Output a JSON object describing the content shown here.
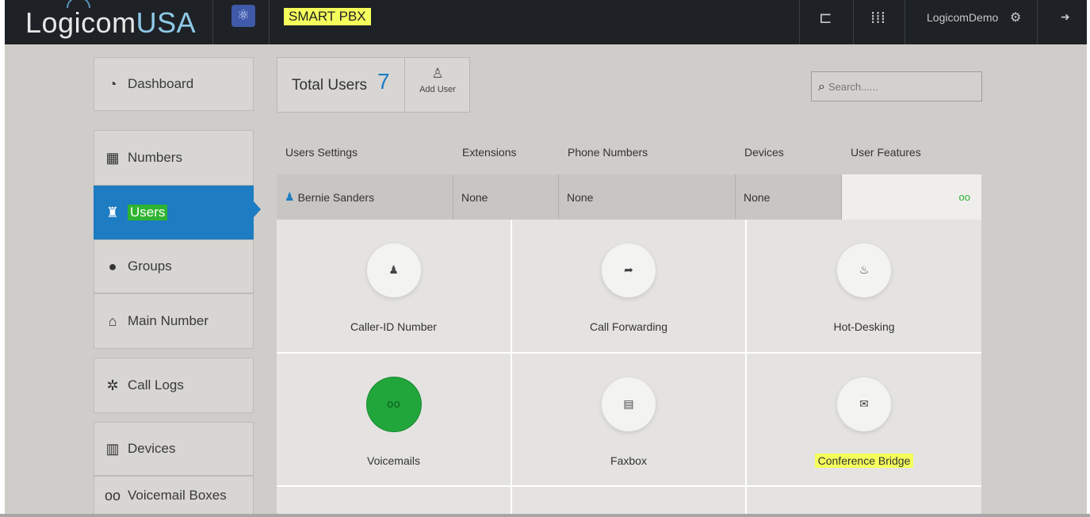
{
  "header": {
    "logo_main": "Logicom",
    "logo_accent": "USA",
    "app_title": "SMART PBX",
    "username": "LogicomDemo",
    "icons": [
      "sitemap-icon",
      "apps-grid-icon",
      "gears-icon",
      "logout-icon"
    ]
  },
  "sidebar": {
    "items": [
      {
        "label": "Dashboard",
        "icon": "dashboard-icon"
      },
      {
        "label": "Numbers",
        "icon": "grid-icon"
      },
      {
        "label": "Users",
        "icon": "users-icon",
        "active": true
      },
      {
        "label": "Groups",
        "icon": "groups-icon"
      },
      {
        "label": "Main Number",
        "icon": "home-icon"
      },
      {
        "label": "Call Logs",
        "icon": "call-logs-icon"
      },
      {
        "label": "Devices",
        "icon": "devices-icon"
      },
      {
        "label": "Voicemail Boxes",
        "icon": "voicemail-icon"
      }
    ],
    "active_color": "#1d7cc2",
    "highlight_color": "#2fb431"
  },
  "summary": {
    "total_users_label": "Total Users",
    "total_users_count": "7",
    "add_user_label": "Add User"
  },
  "search": {
    "placeholder": "Search......"
  },
  "table": {
    "headers": [
      "Users Settings",
      "Extensions",
      "Phone Numbers",
      "Devices",
      "User Features"
    ],
    "row": {
      "name": "Bernie Sanders",
      "extensions": "None",
      "phone_numbers": "None",
      "devices": "None"
    }
  },
  "features": [
    {
      "label": "Caller-ID Number",
      "icon": "user-icon"
    },
    {
      "label": "Call Forwarding",
      "icon": "share-arrow-icon"
    },
    {
      "label": "Hot-Desking",
      "icon": "fire-icon"
    },
    {
      "label": "Voicemails",
      "icon": "voicemail-icon",
      "enabled": true
    },
    {
      "label": "Faxbox",
      "icon": "fax-icon"
    },
    {
      "label": "Conference Bridge",
      "icon": "chat-icon",
      "highlighted": true
    }
  ]
}
